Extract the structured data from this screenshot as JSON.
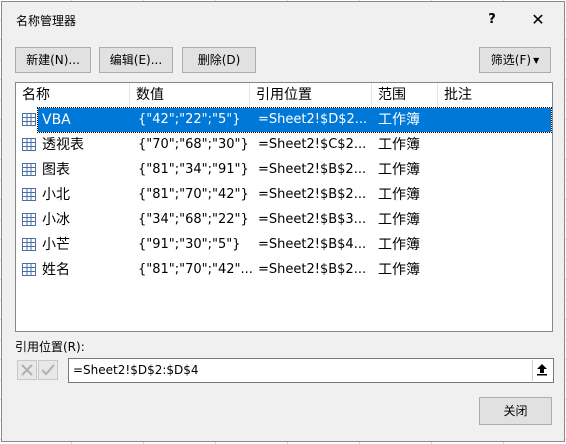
{
  "window": {
    "title": "名称管理器",
    "help_label": "?",
    "close_label": "✕"
  },
  "toolbar": {
    "new_label": "新建(N)...",
    "edit_label": "编辑(E)...",
    "delete_label": "删除(D)",
    "filter_label": "筛选(F)"
  },
  "table": {
    "columns": [
      "名称",
      "数值",
      "引用位置",
      "范围",
      "批注"
    ],
    "rows": [
      {
        "name": "VBA",
        "value": "{\"42\";\"22\";\"5\"}",
        "ref": "=Sheet2!$D$2...",
        "scope": "工作簿",
        "comment": "",
        "selected": true
      },
      {
        "name": "透视表",
        "value": "{\"70\";\"68\";\"30\"}",
        "ref": "=Sheet2!$C$2...",
        "scope": "工作簿",
        "comment": "",
        "selected": false
      },
      {
        "name": "图表",
        "value": "{\"81\";\"34\";\"91\"}",
        "ref": "=Sheet2!$B$2...",
        "scope": "工作簿",
        "comment": "",
        "selected": false
      },
      {
        "name": "小北",
        "value": "{\"81\";\"70\";\"42\"}",
        "ref": "=Sheet2!$B$2...",
        "scope": "工作簿",
        "comment": "",
        "selected": false
      },
      {
        "name": "小冰",
        "value": "{\"34\";\"68\";\"22\"}",
        "ref": "=Sheet2!$B$3...",
        "scope": "工作簿",
        "comment": "",
        "selected": false
      },
      {
        "name": "小芒",
        "value": "{\"91\";\"30\";\"5\"}",
        "ref": "=Sheet2!$B$4...",
        "scope": "工作簿",
        "comment": "",
        "selected": false
      },
      {
        "name": "姓名",
        "value": "{\"81\";\"70\";\"42\"...",
        "ref": "=Sheet2!$B$2...",
        "scope": "工作簿",
        "comment": "",
        "selected": false
      }
    ]
  },
  "reference": {
    "label": "引用位置(R):",
    "value": "=Sheet2!$D$2:$D$4"
  },
  "footer": {
    "close_label": "关闭"
  },
  "colors": {
    "selection": "#0078d7",
    "dialog_bg": "#f0f0f0"
  }
}
